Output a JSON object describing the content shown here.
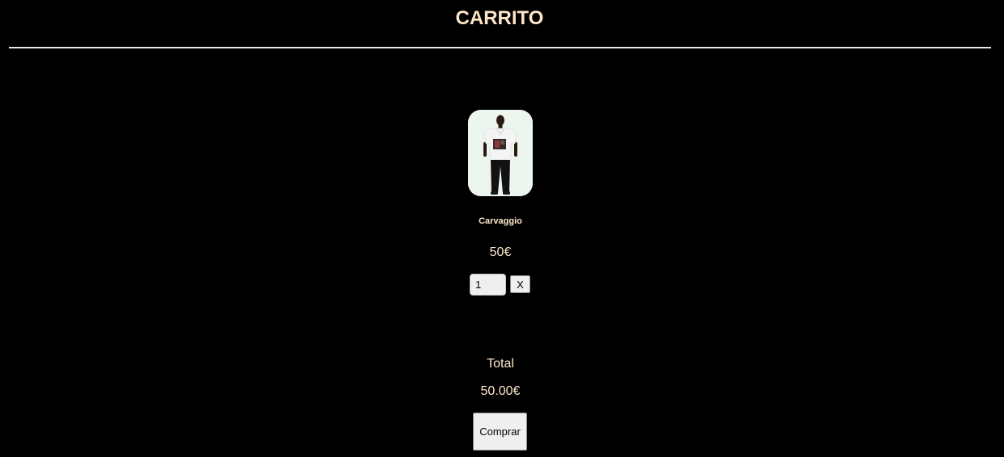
{
  "header": {
    "title": "CARRITO"
  },
  "cart": {
    "items": [
      {
        "name": "Carvaggio",
        "price": "50€",
        "quantity": "1",
        "remove_label": "X",
        "image_icon": "product-photo-shirt-model"
      }
    ]
  },
  "summary": {
    "total_label": "Total",
    "total_value": "50.00€",
    "buy_label": "Comprar"
  },
  "colors": {
    "background": "#000000",
    "text_accent": "#fde6c7",
    "image_background": "#edf6ee",
    "divider": "#e8e8e8",
    "control_background": "#efefef"
  }
}
